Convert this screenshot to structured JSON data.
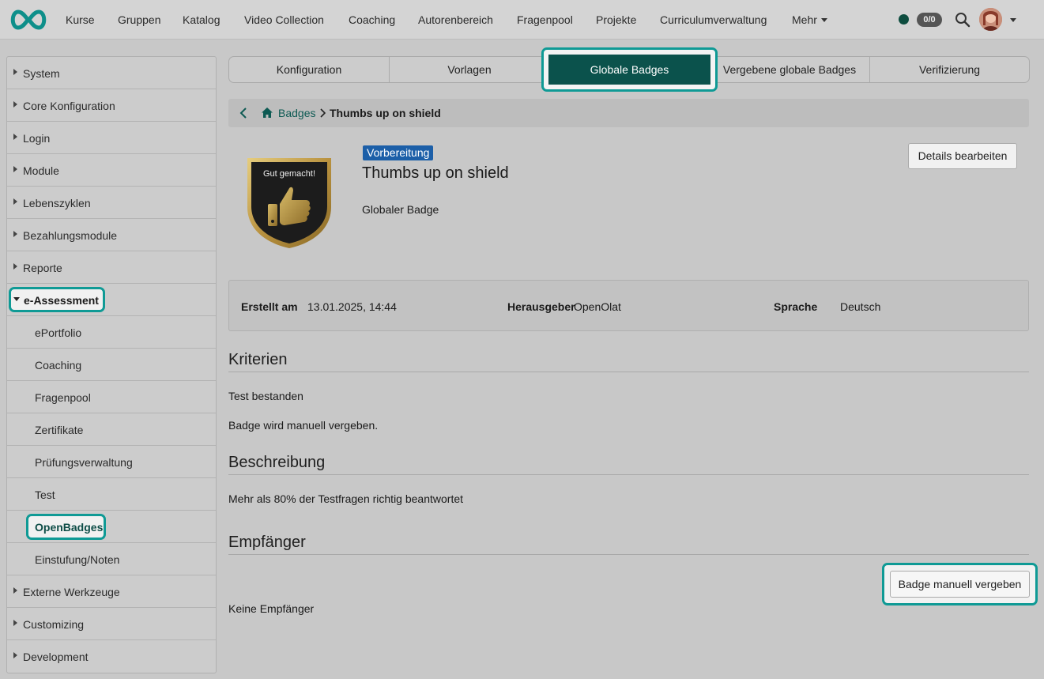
{
  "nav": {
    "items": [
      "Kurse",
      "Gruppen",
      "Katalog",
      "Video Collection",
      "Coaching",
      "Autorenbereich",
      "Fragenpool",
      "Projekte",
      "Curriculumverwaltung",
      "Mehr"
    ],
    "counter": "0/0"
  },
  "sidebar": {
    "items": [
      "System",
      "Core Konfiguration",
      "Login",
      "Module",
      "Lebenszyklen",
      "Bezahlungsmodule",
      "Reporte",
      "e-Assessment",
      "ePortfolio",
      "Coaching",
      "Fragenpool",
      "Zertifikate",
      "Prüfungsverwaltung",
      "Test",
      "OpenBadges",
      "Einstufung/Noten",
      "Externe Werkzeuge",
      "Customizing",
      "Development"
    ]
  },
  "tabs": [
    "Konfiguration",
    "Vorlagen",
    "Globale Badges",
    "Vergebene globale Badges",
    "Verifizierung"
  ],
  "breadcrumb": {
    "link": "Badges",
    "current": "Thumbs up on shield"
  },
  "badge": {
    "status": "Vorbereitung",
    "title": "Thumbs up on shield",
    "type": "Globaler Badge",
    "image_text": "Gut gemacht!",
    "edit_label": "Details bearbeiten"
  },
  "info": {
    "created_label": "Erstellt am",
    "created_value": "13.01.2025, 14:44",
    "issuer_label": "Herausgeber",
    "issuer_value": "OpenOlat",
    "lang_label": "Sprache",
    "lang_value": "Deutsch"
  },
  "criteria": {
    "title": "Kriterien",
    "line1": "Test bestanden",
    "line2": "Badge wird manuell vergeben."
  },
  "description": {
    "title": "Beschreibung",
    "text": "Mehr als 80% der Testfragen richtig beantwortet"
  },
  "recipients": {
    "title": "Empfänger",
    "award_label": "Badge manuell vergeben",
    "empty": "Keine Empfänger"
  },
  "colors": {
    "accent": "#0b524c",
    "highlight": "#0f9a95",
    "status_tag": "#1c5fa8"
  }
}
